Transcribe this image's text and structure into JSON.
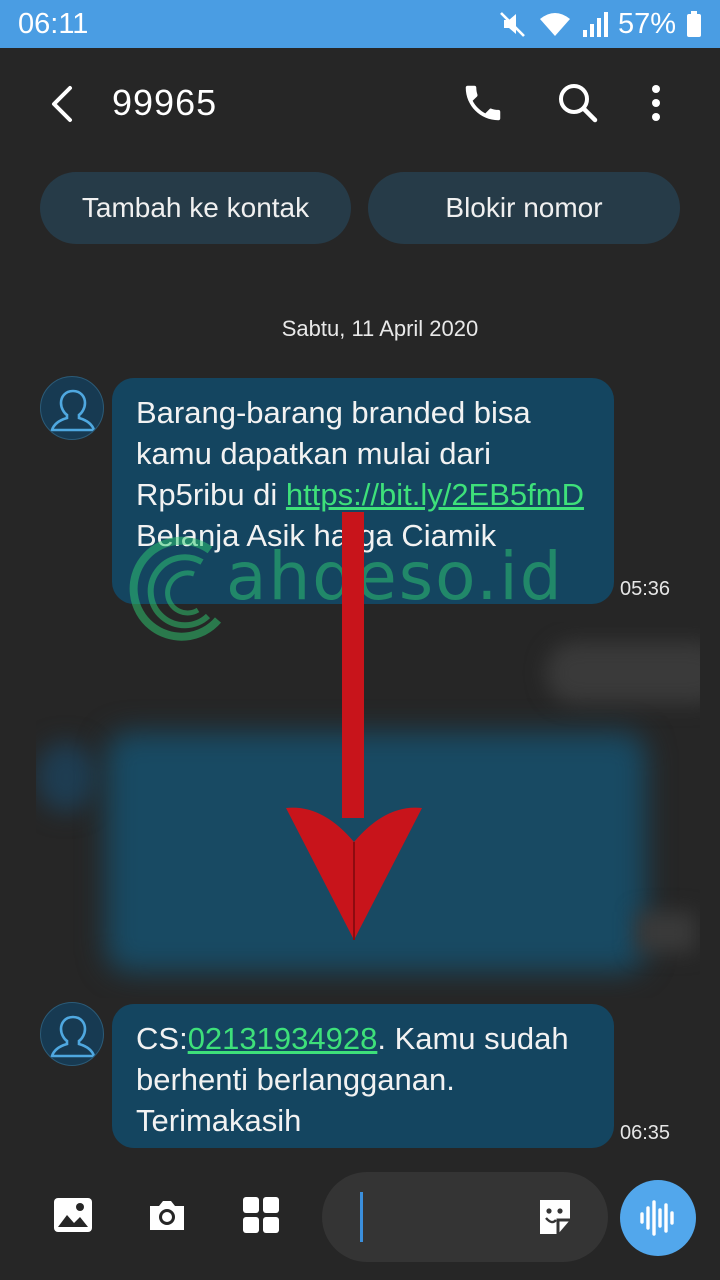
{
  "status": {
    "time": "06:11",
    "battery": "57%"
  },
  "header": {
    "title": "99965"
  },
  "chips": {
    "add_contact": "Tambah ke kontak",
    "block_number": "Blokir nomor"
  },
  "conversation": {
    "date": "Sabtu, 11 April 2020",
    "messages": [
      {
        "text_before": "Barang-barang branded bisa kamu dapatkan mulai dari Rp5ribu di ",
        "link": "https://bit.ly/2EB5fmD",
        "text_after": " Belanja Asik harga Ciamik",
        "time": "05:36"
      },
      {
        "prefix": "CS:",
        "phone": "02131934928",
        "text_after": ". Kamu sudah berhenti berlangganan. Terimakasih",
        "time": "06:35"
      }
    ]
  },
  "watermark": {
    "text": "ahdeso.id"
  },
  "icons": {
    "back": "back-arrow-icon",
    "call": "phone-icon",
    "search": "search-icon",
    "more": "more-vert-icon",
    "gallery": "image-icon",
    "camera": "camera-icon",
    "apps": "apps-grid-icon",
    "sticker": "sticker-icon",
    "voice": "voice-input-icon"
  },
  "colors": {
    "status_bar": "#4a9de3",
    "bubble": "#144560",
    "link": "#3ee07a",
    "arrow": "#c8141b",
    "accent": "#52a7ec"
  }
}
